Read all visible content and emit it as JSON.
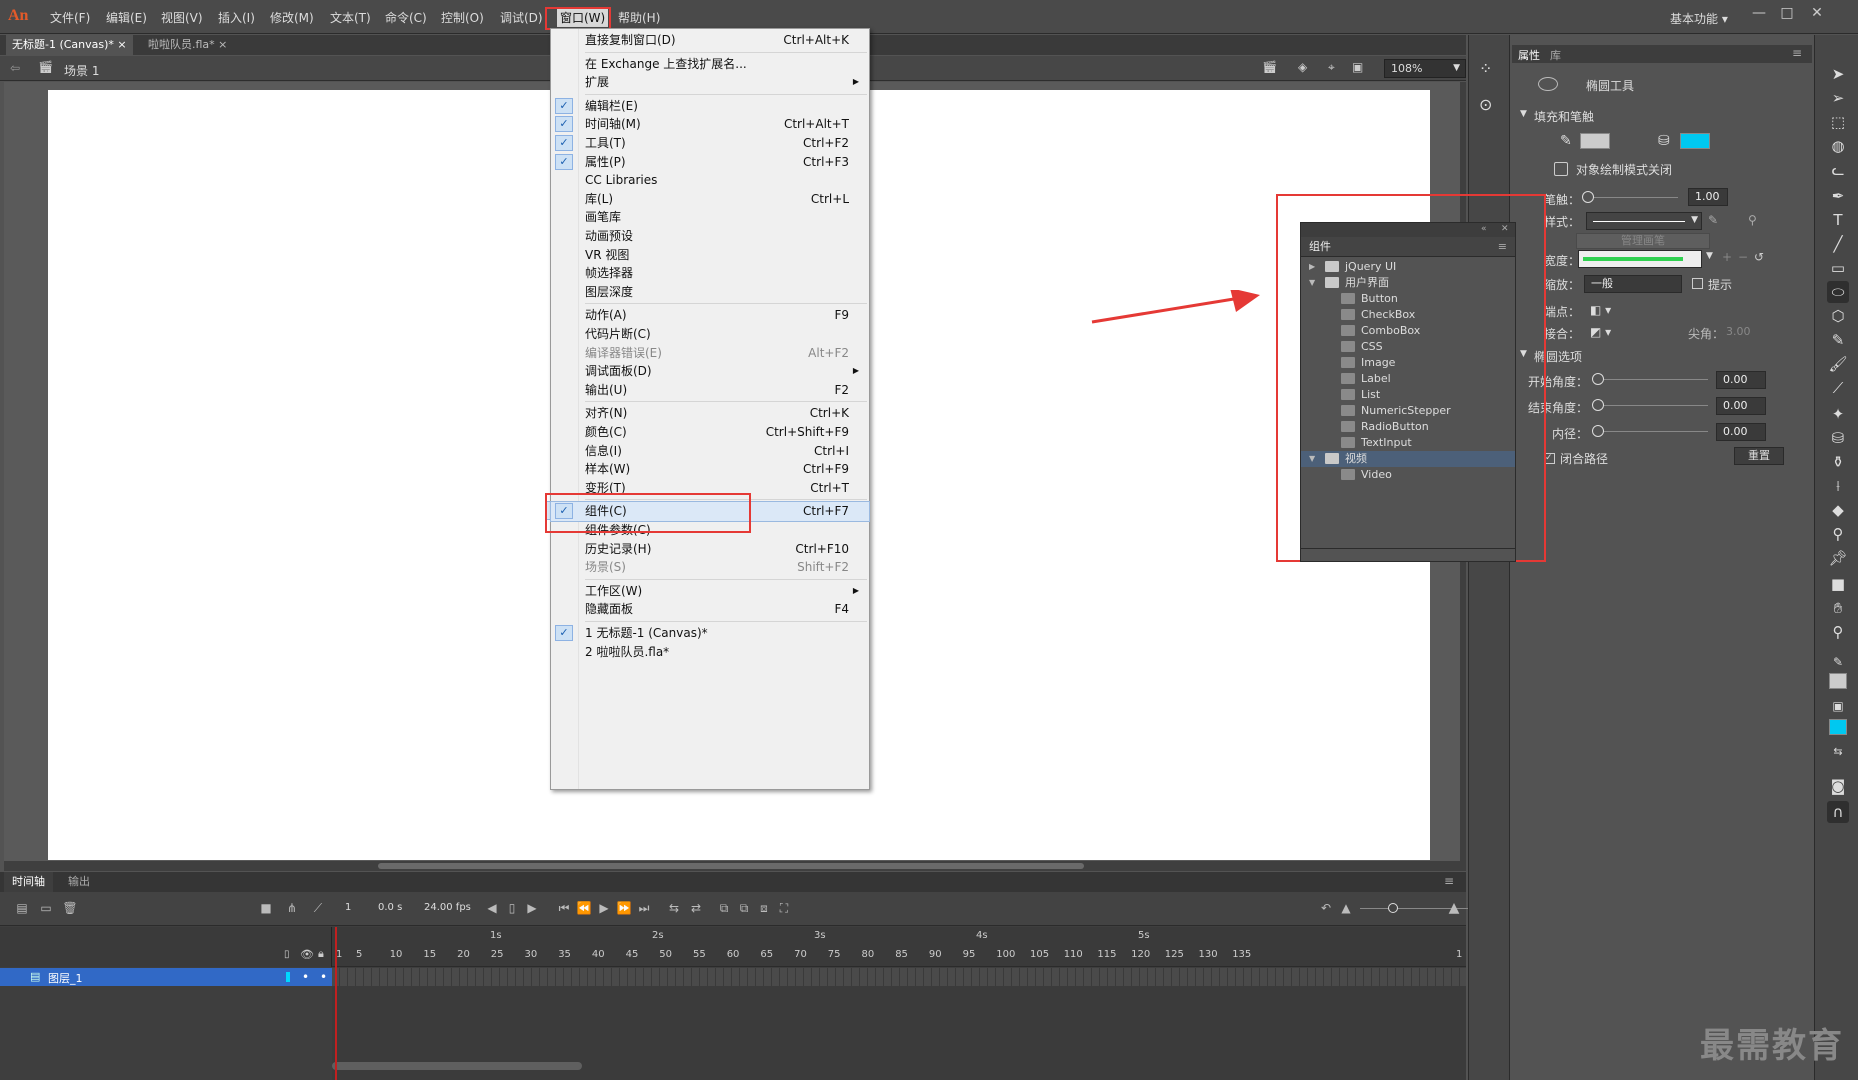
{
  "menubar": {
    "logo": "An",
    "items": [
      "文件(F)",
      "编辑(E)",
      "视图(V)",
      "插入(I)",
      "修改(M)",
      "文本(T)",
      "命令(C)",
      "控制(O)",
      "调试(D)",
      "窗口(W)",
      "帮助(H)"
    ],
    "workspace": "基本功能",
    "workspace_arrow": "▾",
    "min": "—",
    "max": "□",
    "close": "✕"
  },
  "doctabs": [
    {
      "label": "无标题-1 (Canvas)*",
      "close": "×"
    },
    {
      "label": "啦啦队员.fla*",
      "close": "×"
    }
  ],
  "scenebar": {
    "scene": "场景 1",
    "zoom": "108%"
  },
  "window_menu": {
    "items": [
      {
        "label": "直接复制窗口(D)",
        "shortcut": "Ctrl+Alt+K"
      },
      {
        "sep": true
      },
      {
        "label": "在 Exchange 上查找扩展名...",
        "shortcut": ""
      },
      {
        "label": "扩展",
        "shortcut": "",
        "submenu": true
      },
      {
        "sep": true
      },
      {
        "label": "编辑栏(E)",
        "shortcut": "",
        "checked": true
      },
      {
        "label": "时间轴(M)",
        "shortcut": "Ctrl+Alt+T",
        "checked": true
      },
      {
        "label": "工具(T)",
        "shortcut": "Ctrl+F2",
        "checked": true
      },
      {
        "label": "属性(P)",
        "shortcut": "Ctrl+F3",
        "checked": true
      },
      {
        "label": "CC Libraries",
        "shortcut": ""
      },
      {
        "label": "库(L)",
        "shortcut": "Ctrl+L"
      },
      {
        "label": "画笔库",
        "shortcut": ""
      },
      {
        "label": "动画预设",
        "shortcut": ""
      },
      {
        "label": "VR 视图",
        "shortcut": ""
      },
      {
        "label": "帧选择器",
        "shortcut": ""
      },
      {
        "label": "图层深度",
        "shortcut": ""
      },
      {
        "sep": true
      },
      {
        "label": "动作(A)",
        "shortcut": "F9"
      },
      {
        "label": "代码片断(C)",
        "shortcut": ""
      },
      {
        "label": "编译器错误(E)",
        "shortcut": "Alt+F2",
        "disabled": true
      },
      {
        "label": "调试面板(D)",
        "shortcut": "",
        "submenu": true
      },
      {
        "label": "输出(U)",
        "shortcut": "F2"
      },
      {
        "sep": true
      },
      {
        "label": "对齐(N)",
        "shortcut": "Ctrl+K"
      },
      {
        "label": "颜色(C)",
        "shortcut": "Ctrl+Shift+F9"
      },
      {
        "label": "信息(I)",
        "shortcut": "Ctrl+I"
      },
      {
        "label": "样本(W)",
        "shortcut": "Ctrl+F9"
      },
      {
        "label": "变形(T)",
        "shortcut": "Ctrl+T"
      },
      {
        "sep": true
      },
      {
        "label": "组件(C)",
        "shortcut": "Ctrl+F7",
        "checked": true,
        "highlight": true
      },
      {
        "label": "组件参数(C)",
        "shortcut": ""
      },
      {
        "label": "历史记录(H)",
        "shortcut": "Ctrl+F10"
      },
      {
        "label": "场景(S)",
        "shortcut": "Shift+F2",
        "disabled": true
      },
      {
        "sep": true
      },
      {
        "label": "工作区(W)",
        "shortcut": "",
        "submenu": true
      },
      {
        "label": "隐藏面板",
        "shortcut": "F4"
      },
      {
        "sep": true
      },
      {
        "label": "1 无标题-1 (Canvas)*",
        "shortcut": "",
        "checked": true
      },
      {
        "label": "2 啦啦队员.fla*",
        "shortcut": ""
      }
    ]
  },
  "components_panel": {
    "title": "组件",
    "items": [
      {
        "label": "jQuery UI",
        "level": 0,
        "folder": true,
        "expanded": false
      },
      {
        "label": "用户界面",
        "level": 0,
        "folder": true,
        "expanded": true
      },
      {
        "label": "Button",
        "level": 1
      },
      {
        "label": "CheckBox",
        "level": 1
      },
      {
        "label": "ComboBox",
        "level": 1
      },
      {
        "label": "CSS",
        "level": 1
      },
      {
        "label": "Image",
        "level": 1
      },
      {
        "label": "Label",
        "level": 1
      },
      {
        "label": "List",
        "level": 1
      },
      {
        "label": "NumericStepper",
        "level": 1
      },
      {
        "label": "RadioButton",
        "level": 1
      },
      {
        "label": "TextInput",
        "level": 1
      },
      {
        "label": "视频",
        "level": 0,
        "folder": true,
        "expanded": true,
        "selected": true
      },
      {
        "label": "Video",
        "level": 1
      }
    ]
  },
  "properties": {
    "tabs": [
      "属性",
      "库"
    ],
    "tool_name": "椭圆工具",
    "fill_stroke": "填充和笔触",
    "fill_color": "#00c8f0",
    "stroke_color": "#cccccc",
    "draw_mode": "对象绘制模式关闭",
    "stroke_label": "笔触：",
    "stroke_value": "1.00",
    "style_label": "样式：",
    "manage_brush": "管理画笔",
    "width_label": "宽度：",
    "scale_label": "缩放：",
    "scale_value": "一般",
    "hint_label": "提示",
    "cap_label": "端点：",
    "join_label": "接合：",
    "miter_label": "尖角：",
    "miter_value": "3.00",
    "ellipse_options": "椭圆选项",
    "start_angle_label": "开始角度：",
    "start_angle": "0.00",
    "end_angle_label": "结束角度：",
    "end_angle": "0.00",
    "inner_label": "内径：",
    "inner_value": "0.00",
    "close_path": "闭合路径",
    "reset": "重置"
  },
  "timeline": {
    "tabs": [
      "时间轴",
      "输出"
    ],
    "frame": "1",
    "time": "0.0 s",
    "fps": "24.00 fps",
    "layer": "图层_1",
    "ruler_nums": [
      "1",
      "5",
      "10",
      "15",
      "20",
      "25",
      "30",
      "35",
      "40",
      "45",
      "50",
      "55",
      "60",
      "65",
      "70",
      "75",
      "80",
      "85",
      "90",
      "95",
      "100",
      "105",
      "110",
      "115",
      "120",
      "125",
      "130",
      "135",
      "1"
    ],
    "seconds": [
      "1s",
      "2s",
      "3s",
      "4s",
      "5s"
    ]
  },
  "watermark": "最需教育"
}
